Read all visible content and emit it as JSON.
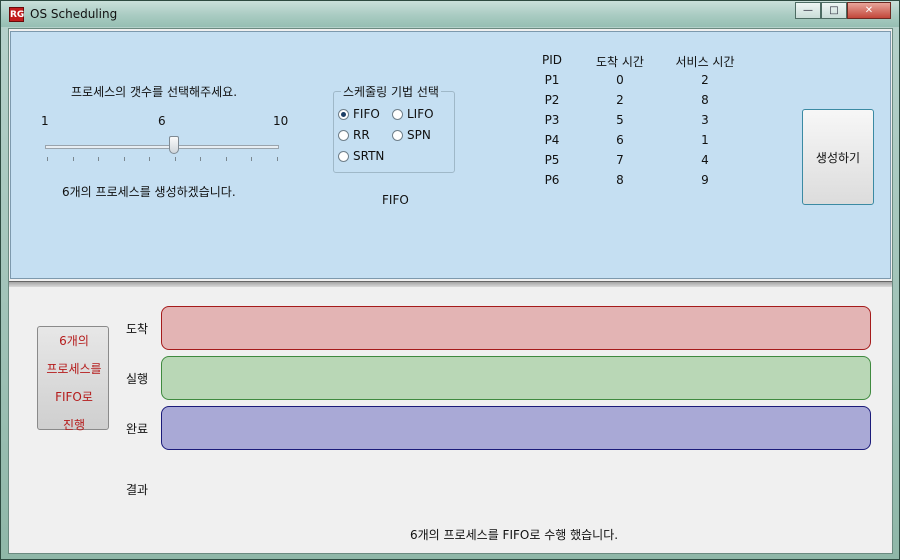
{
  "window": {
    "title": "OS Scheduling",
    "app_icon_text": "RG",
    "controls": {
      "minimize": "—",
      "maximize": "□",
      "close": "✕"
    }
  },
  "process_count": {
    "prompt": "프로세스의 갯수를 선택해주세요.",
    "min_label": "1",
    "current_label": "6",
    "max_label": "10",
    "value": 6,
    "min": 1,
    "max": 10,
    "message": "6개의 프로세스를 생성하겠습니다."
  },
  "algorithm": {
    "group_title": "스케줄링 기법 선택",
    "options": [
      {
        "label": "FIFO",
        "selected": true
      },
      {
        "label": "LIFO",
        "selected": false
      },
      {
        "label": "RR",
        "selected": false
      },
      {
        "label": "SPN",
        "selected": false
      },
      {
        "label": "SRTN",
        "selected": false
      }
    ],
    "selected_display": "FIFO"
  },
  "process_table": {
    "headers": [
      "PID",
      "도착 시간",
      "서비스 시간"
    ],
    "rows": [
      [
        "P1",
        "0",
        "2"
      ],
      [
        "P2",
        "2",
        "8"
      ],
      [
        "P3",
        "5",
        "3"
      ],
      [
        "P4",
        "6",
        "1"
      ],
      [
        "P5",
        "7",
        "4"
      ],
      [
        "P6",
        "8",
        "9"
      ]
    ]
  },
  "generate_button": {
    "label": "생성하기"
  },
  "status_box": {
    "lines": [
      "6개의",
      "프로세스를",
      "FIFO로",
      "진행"
    ]
  },
  "lanes": {
    "arrive_label": "도착",
    "run_label": "실행",
    "done_label": "완료"
  },
  "result": {
    "label": "결과",
    "summary": "6개의 프로세스를 FIFO로 수행 했습니다."
  },
  "colors": {
    "top_panel_bg": "#c5dff2",
    "arrive_fill": "#e3b4b4",
    "run_fill": "#b9d7b6",
    "done_fill": "#a9a9d6",
    "status_text": "#b51b1b"
  }
}
